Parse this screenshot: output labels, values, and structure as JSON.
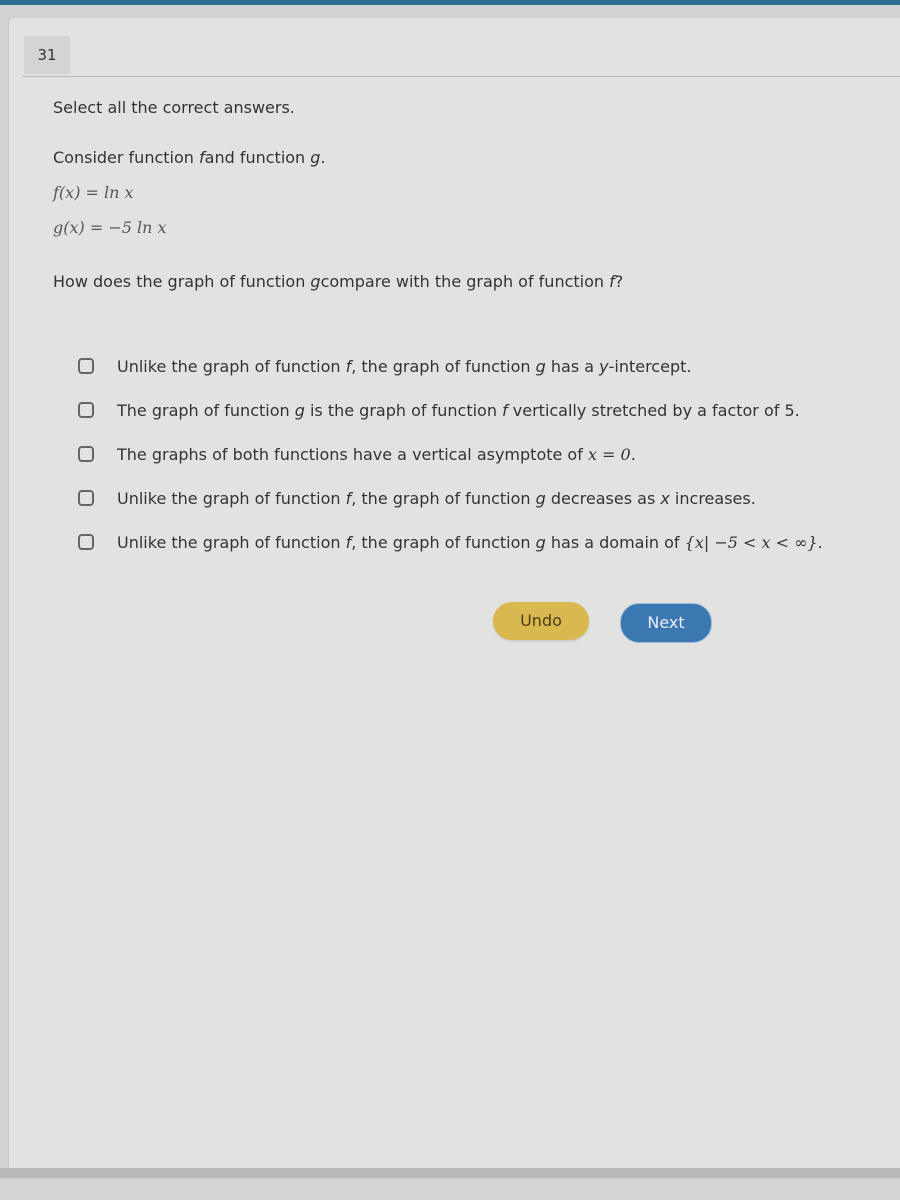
{
  "question_number": "31",
  "instructions": "Select all the correct answers.",
  "intro": {
    "prefix": "Consider function ",
    "f": "f",
    "middle": "and function ",
    "g": "g",
    "suffix": "."
  },
  "functions": {
    "f": "f(x) = ln x",
    "g": "g(x) = −5 ln x"
  },
  "question": {
    "prefix": "How does the graph of function ",
    "g": "g",
    "middle": "compare with the graph of function ",
    "f": "f",
    "suffix": "?"
  },
  "options": [
    {
      "parts": [
        "Unlike the graph of function ",
        "f",
        ", the graph of function ",
        "g",
        " has a ",
        "y",
        "-intercept."
      ],
      "checked": false
    },
    {
      "parts": [
        "The graph of function ",
        "g",
        " is the graph of function ",
        "f",
        " vertically stretched by a factor of 5."
      ],
      "checked": false
    },
    {
      "parts": [
        "The graphs of both functions have a vertical asymptote of ",
        "x = 0",
        "."
      ],
      "checked": false
    },
    {
      "parts": [
        "Unlike the graph of function ",
        "f",
        ", the graph of function ",
        "g",
        " decreases as ",
        "x",
        " increases."
      ],
      "checked": false
    },
    {
      "parts": [
        "Unlike the graph of function ",
        "f",
        ", the graph of function ",
        "g",
        " has a domain of ",
        "{x| −5 < x < ∞}",
        "."
      ],
      "checked": false
    }
  ],
  "buttons": {
    "undo": "Undo",
    "next": "Next"
  },
  "colors": {
    "undo_bg": "#d9b94f",
    "next_bg": "#3b78b2",
    "top_bar": "#2f6f93"
  }
}
